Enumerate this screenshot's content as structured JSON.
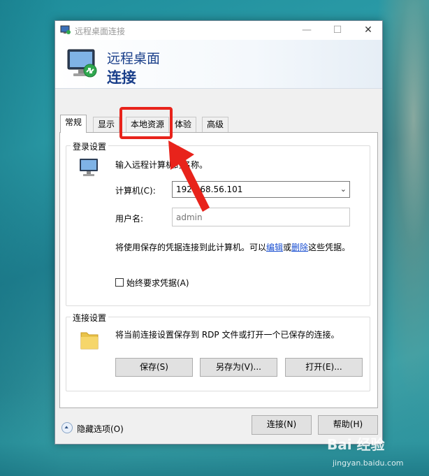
{
  "window": {
    "title": "远程桌面连接",
    "controls": {
      "minimize": "—",
      "maximize": "☐",
      "close": "✕"
    }
  },
  "banner": {
    "line1": "远程桌面",
    "line2": "连接"
  },
  "tabs": [
    {
      "label": "常规",
      "active": true
    },
    {
      "label": "显示"
    },
    {
      "label": "本地资源"
    },
    {
      "label": "体验"
    },
    {
      "label": "高级"
    }
  ],
  "login": {
    "legend": "登录设置",
    "prompt": "输入远程计算机的名称。",
    "computer_label": "计算机(C):",
    "computer_value": "192.168.56.101",
    "user_label": "用户名:",
    "user_placeholder": "admin",
    "note_prefix": "将使用保存的凭据连接到此计算机。可以",
    "note_edit": "编辑",
    "note_or": "或",
    "note_delete": "删除",
    "note_suffix": "这些凭据。",
    "always_ask": "始终要求凭据(A)"
  },
  "connection": {
    "legend": "连接设置",
    "desc": "将当前连接设置保存到 RDP 文件或打开一个已保存的连接。",
    "save": "保存(S)",
    "save_as": "另存为(V)...",
    "open": "打开(E)..."
  },
  "footer": {
    "hide_options": "隐藏选项(O)",
    "connect": "连接(N)",
    "help": "帮助(H)"
  },
  "watermark": {
    "main": "Bai 经验",
    "sub": "jingyan.baidu.com"
  },
  "colors": {
    "accent": "#1a3f8a",
    "highlight": "#e8231b",
    "link": "#1a4fd1"
  }
}
